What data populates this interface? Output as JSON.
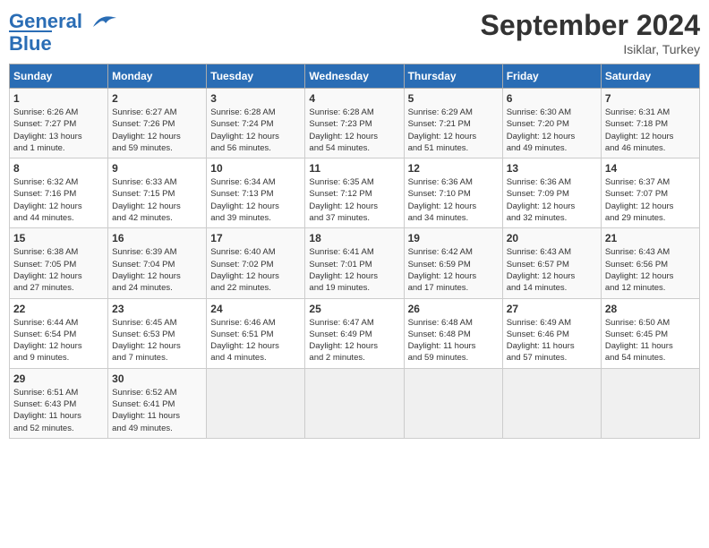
{
  "header": {
    "logo_line1": "General",
    "logo_line2": "Blue",
    "month": "September 2024",
    "location": "Isiklar, Turkey"
  },
  "days_of_week": [
    "Sunday",
    "Monday",
    "Tuesday",
    "Wednesday",
    "Thursday",
    "Friday",
    "Saturday"
  ],
  "weeks": [
    [
      {
        "day": 1,
        "lines": [
          "Sunrise: 6:26 AM",
          "Sunset: 7:27 PM",
          "Daylight: 13 hours",
          "and 1 minute."
        ]
      },
      {
        "day": 2,
        "lines": [
          "Sunrise: 6:27 AM",
          "Sunset: 7:26 PM",
          "Daylight: 12 hours",
          "and 59 minutes."
        ]
      },
      {
        "day": 3,
        "lines": [
          "Sunrise: 6:28 AM",
          "Sunset: 7:24 PM",
          "Daylight: 12 hours",
          "and 56 minutes."
        ]
      },
      {
        "day": 4,
        "lines": [
          "Sunrise: 6:28 AM",
          "Sunset: 7:23 PM",
          "Daylight: 12 hours",
          "and 54 minutes."
        ]
      },
      {
        "day": 5,
        "lines": [
          "Sunrise: 6:29 AM",
          "Sunset: 7:21 PM",
          "Daylight: 12 hours",
          "and 51 minutes."
        ]
      },
      {
        "day": 6,
        "lines": [
          "Sunrise: 6:30 AM",
          "Sunset: 7:20 PM",
          "Daylight: 12 hours",
          "and 49 minutes."
        ]
      },
      {
        "day": 7,
        "lines": [
          "Sunrise: 6:31 AM",
          "Sunset: 7:18 PM",
          "Daylight: 12 hours",
          "and 46 minutes."
        ]
      }
    ],
    [
      {
        "day": 8,
        "lines": [
          "Sunrise: 6:32 AM",
          "Sunset: 7:16 PM",
          "Daylight: 12 hours",
          "and 44 minutes."
        ]
      },
      {
        "day": 9,
        "lines": [
          "Sunrise: 6:33 AM",
          "Sunset: 7:15 PM",
          "Daylight: 12 hours",
          "and 42 minutes."
        ]
      },
      {
        "day": 10,
        "lines": [
          "Sunrise: 6:34 AM",
          "Sunset: 7:13 PM",
          "Daylight: 12 hours",
          "and 39 minutes."
        ]
      },
      {
        "day": 11,
        "lines": [
          "Sunrise: 6:35 AM",
          "Sunset: 7:12 PM",
          "Daylight: 12 hours",
          "and 37 minutes."
        ]
      },
      {
        "day": 12,
        "lines": [
          "Sunrise: 6:36 AM",
          "Sunset: 7:10 PM",
          "Daylight: 12 hours",
          "and 34 minutes."
        ]
      },
      {
        "day": 13,
        "lines": [
          "Sunrise: 6:36 AM",
          "Sunset: 7:09 PM",
          "Daylight: 12 hours",
          "and 32 minutes."
        ]
      },
      {
        "day": 14,
        "lines": [
          "Sunrise: 6:37 AM",
          "Sunset: 7:07 PM",
          "Daylight: 12 hours",
          "and 29 minutes."
        ]
      }
    ],
    [
      {
        "day": 15,
        "lines": [
          "Sunrise: 6:38 AM",
          "Sunset: 7:05 PM",
          "Daylight: 12 hours",
          "and 27 minutes."
        ]
      },
      {
        "day": 16,
        "lines": [
          "Sunrise: 6:39 AM",
          "Sunset: 7:04 PM",
          "Daylight: 12 hours",
          "and 24 minutes."
        ]
      },
      {
        "day": 17,
        "lines": [
          "Sunrise: 6:40 AM",
          "Sunset: 7:02 PM",
          "Daylight: 12 hours",
          "and 22 minutes."
        ]
      },
      {
        "day": 18,
        "lines": [
          "Sunrise: 6:41 AM",
          "Sunset: 7:01 PM",
          "Daylight: 12 hours",
          "and 19 minutes."
        ]
      },
      {
        "day": 19,
        "lines": [
          "Sunrise: 6:42 AM",
          "Sunset: 6:59 PM",
          "Daylight: 12 hours",
          "and 17 minutes."
        ]
      },
      {
        "day": 20,
        "lines": [
          "Sunrise: 6:43 AM",
          "Sunset: 6:57 PM",
          "Daylight: 12 hours",
          "and 14 minutes."
        ]
      },
      {
        "day": 21,
        "lines": [
          "Sunrise: 6:43 AM",
          "Sunset: 6:56 PM",
          "Daylight: 12 hours",
          "and 12 minutes."
        ]
      }
    ],
    [
      {
        "day": 22,
        "lines": [
          "Sunrise: 6:44 AM",
          "Sunset: 6:54 PM",
          "Daylight: 12 hours",
          "and 9 minutes."
        ]
      },
      {
        "day": 23,
        "lines": [
          "Sunrise: 6:45 AM",
          "Sunset: 6:53 PM",
          "Daylight: 12 hours",
          "and 7 minutes."
        ]
      },
      {
        "day": 24,
        "lines": [
          "Sunrise: 6:46 AM",
          "Sunset: 6:51 PM",
          "Daylight: 12 hours",
          "and 4 minutes."
        ]
      },
      {
        "day": 25,
        "lines": [
          "Sunrise: 6:47 AM",
          "Sunset: 6:49 PM",
          "Daylight: 12 hours",
          "and 2 minutes."
        ]
      },
      {
        "day": 26,
        "lines": [
          "Sunrise: 6:48 AM",
          "Sunset: 6:48 PM",
          "Daylight: 11 hours",
          "and 59 minutes."
        ]
      },
      {
        "day": 27,
        "lines": [
          "Sunrise: 6:49 AM",
          "Sunset: 6:46 PM",
          "Daylight: 11 hours",
          "and 57 minutes."
        ]
      },
      {
        "day": 28,
        "lines": [
          "Sunrise: 6:50 AM",
          "Sunset: 6:45 PM",
          "Daylight: 11 hours",
          "and 54 minutes."
        ]
      }
    ],
    [
      {
        "day": 29,
        "lines": [
          "Sunrise: 6:51 AM",
          "Sunset: 6:43 PM",
          "Daylight: 11 hours",
          "and 52 minutes."
        ]
      },
      {
        "day": 30,
        "lines": [
          "Sunrise: 6:52 AM",
          "Sunset: 6:41 PM",
          "Daylight: 11 hours",
          "and 49 minutes."
        ]
      },
      null,
      null,
      null,
      null,
      null
    ]
  ]
}
